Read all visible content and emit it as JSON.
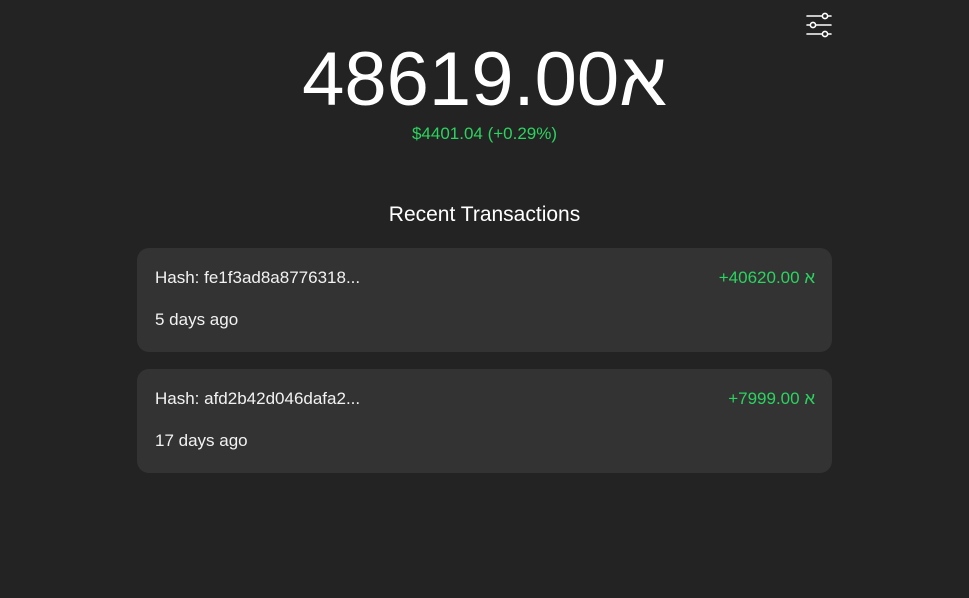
{
  "header": {
    "settings_icon": "sliders-icon"
  },
  "balance": {
    "amount": "א48619.00",
    "fiat_value": "$4401.04 (+0.29%)"
  },
  "transactions": {
    "title": "Recent Transactions",
    "items": [
      {
        "hash": "Hash: fe1f3ad8a8776318...",
        "amount": "+40620.00 א",
        "time": "5 days ago"
      },
      {
        "hash": "Hash: afd2b42d046dafa2...",
        "amount": "+7999.00 א",
        "time": "17 days ago"
      }
    ]
  },
  "colors": {
    "background": "#232323",
    "card": "#333333",
    "positive": "#2bd35f",
    "text": "#ffffff"
  }
}
